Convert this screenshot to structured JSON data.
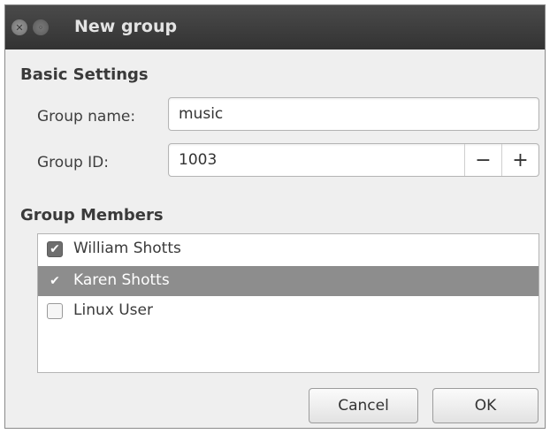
{
  "window": {
    "title": "New group"
  },
  "basic_settings": {
    "heading": "Basic Settings",
    "group_name": {
      "label": "Group name:",
      "value": "music"
    },
    "group_id": {
      "label": "Group ID:",
      "value": "1003",
      "decrement": "−",
      "increment": "+"
    }
  },
  "group_members": {
    "heading": "Group Members",
    "members": [
      {
        "name": "William Shotts",
        "checked": true,
        "selected": false
      },
      {
        "name": "Karen Shotts",
        "checked": true,
        "selected": true
      },
      {
        "name": "Linux User",
        "checked": false,
        "selected": false
      }
    ]
  },
  "buttons": {
    "cancel": "Cancel",
    "ok": "OK"
  },
  "icons": {
    "close": "close-icon",
    "minimize": "minimize-icon",
    "check": "check-icon"
  }
}
